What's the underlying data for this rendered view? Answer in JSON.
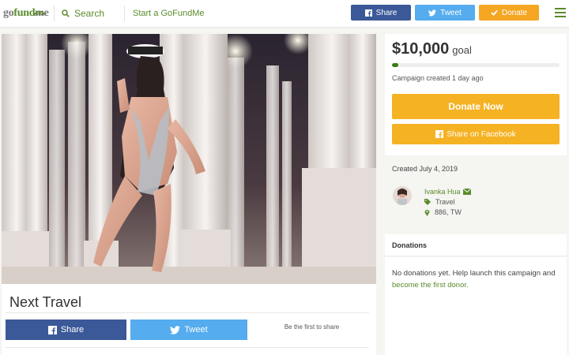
{
  "header": {
    "logo": {
      "part1": "go",
      "part2": "fund",
      "part3": "me"
    },
    "search_label": "Search",
    "start_label": "Start a GoFundMe",
    "share_label": "Share",
    "tweet_label": "Tweet",
    "donate_label": "Donate"
  },
  "campaign": {
    "title": "Next Travel",
    "share_label": "Share",
    "tweet_label": "Tweet",
    "first_to_share": "Be the first to share"
  },
  "goal": {
    "amount": "$10,000",
    "label": "goal",
    "progress_fraction": 0.04,
    "created_ago": "Campaign created 1 day ago",
    "donate_now": "Donate Now",
    "share_facebook": "Share on Facebook"
  },
  "organizer": {
    "created_date": "Created July 4, 2019",
    "name": "Ivanka Hua",
    "category": "Travel",
    "location": "886, TW"
  },
  "donations": {
    "heading": "Donations",
    "empty_text": "No donations yet. Help launch this campaign and ",
    "cta_link": "become the first donor."
  },
  "colors": {
    "brand_green": "#5a8b2c",
    "facebook_blue": "#3b5998",
    "twitter_blue": "#55acee",
    "donate_orange": "#f5a623"
  },
  "icons": {
    "search": "search-icon",
    "facebook": "facebook-icon",
    "twitter": "twitter-icon",
    "check": "check-icon",
    "menu": "hamburger-menu-icon",
    "heart": "heart-icon",
    "envelope": "envelope-icon",
    "tag": "tag-icon",
    "pin": "location-pin-icon"
  }
}
